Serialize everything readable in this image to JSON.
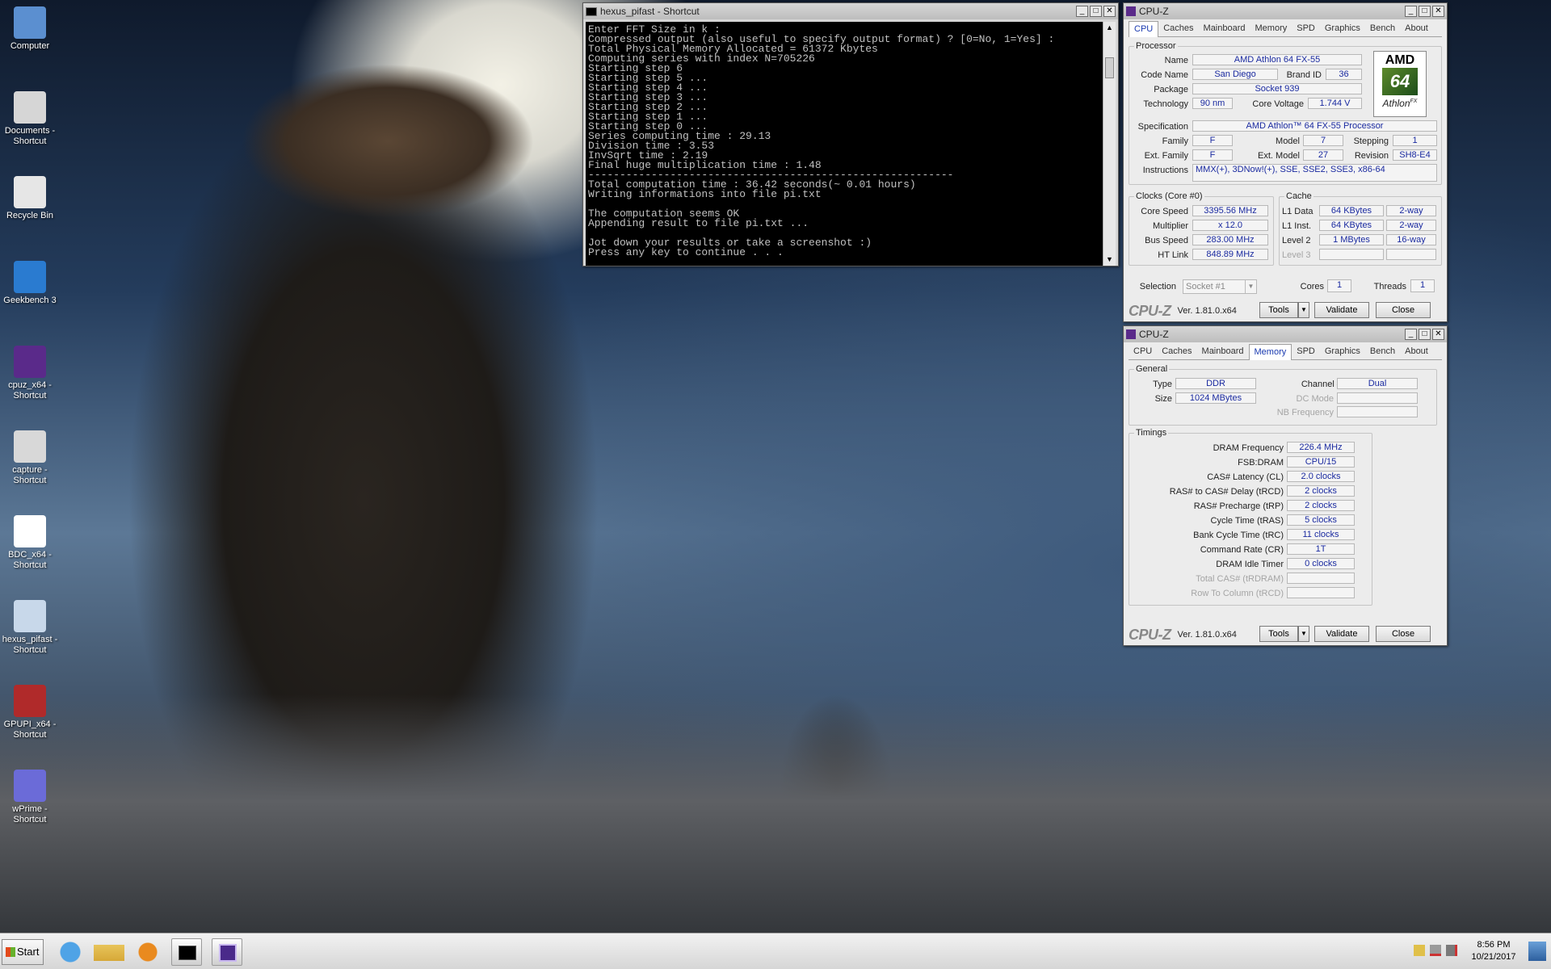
{
  "desktop": {
    "icons": [
      {
        "label": "Computer",
        "icon": "computer-icon"
      },
      {
        "label": "Documents - Shortcut",
        "icon": "documents-icon"
      },
      {
        "label": "Recycle Bin",
        "icon": "recycle-bin-icon"
      },
      {
        "label": "Geekbench 3",
        "icon": "geekbench-icon"
      },
      {
        "label": "cpuz_x64 - Shortcut",
        "icon": "cpuz-icon"
      },
      {
        "label": "capture - Shortcut",
        "icon": "capture-icon"
      },
      {
        "label": "BDC_x64 - Shortcut",
        "icon": "bdc-icon"
      },
      {
        "label": "hexus_pifast - Shortcut",
        "icon": "pifast-icon"
      },
      {
        "label": "GPUPI_x64 - Shortcut",
        "icon": "gpupi-icon"
      },
      {
        "label": "wPrime - Shortcut",
        "icon": "wprime-icon"
      }
    ]
  },
  "console": {
    "title": "hexus_pifast - Shortcut",
    "lines": [
      "Enter FFT Size in k :",
      "Compressed output (also useful to specify output format) ? [0=No, 1=Yes] :",
      "Total Physical Memory Allocated = 61372 Kbytes",
      "Computing series with index N=705226",
      "Starting step 6",
      "Starting step 5 ...",
      "Starting step 4 ...",
      "Starting step 3 ...",
      "Starting step 2 ...",
      "Starting step 1 ...",
      "Starting step 0 ...",
      "Series computing time : 29.13",
      "Division time : 3.53",
      "InvSqrt time : 2.19",
      "Final huge multiplication time : 1.48",
      "----------------------------------------------------------",
      "Total computation time : 36.42 seconds(~ 0.01 hours)",
      "Writing informations into file pi.txt",
      "",
      "The computation seems OK",
      "Appending result to file pi.txt ...",
      "",
      "Jot down your results or take a screenshot :)",
      "Press any key to continue . . ."
    ]
  },
  "cpuz_common": {
    "title": "CPU-Z",
    "tabs": [
      "CPU",
      "Caches",
      "Mainboard",
      "Memory",
      "SPD",
      "Graphics",
      "Bench",
      "About"
    ],
    "logo": "CPU-Z",
    "version": "Ver. 1.81.0.x64",
    "tools_label": "Tools",
    "validate_label": "Validate",
    "close_label": "Close"
  },
  "cpu_tab": {
    "processor_group": "Processor",
    "name_label": "Name",
    "name": "AMD Athlon 64 FX-55",
    "codename_label": "Code Name",
    "codename": "San Diego",
    "brandid_label": "Brand ID",
    "brandid": "36",
    "package_label": "Package",
    "package": "Socket 939",
    "technology_label": "Technology",
    "technology": "90 nm",
    "corevoltage_label": "Core Voltage",
    "corevoltage": "1.744 V",
    "specification_label": "Specification",
    "specification": "AMD Athlon™ 64 FX-55 Processor",
    "family_label": "Family",
    "family": "F",
    "model_label": "Model",
    "model": "7",
    "stepping_label": "Stepping",
    "stepping": "1",
    "extfamily_label": "Ext. Family",
    "extfamily": "F",
    "extmodel_label": "Ext. Model",
    "extmodel": "27",
    "revision_label": "Revision",
    "revision": "SH8-E4",
    "instructions_label": "Instructions",
    "instructions": "MMX(+), 3DNow!(+), SSE, SSE2, SSE3, x86-64",
    "clocks_group": "Clocks (Core #0)",
    "corespeed_label": "Core Speed",
    "corespeed": "3395.56 MHz",
    "multiplier_label": "Multiplier",
    "multiplier": "x 12.0",
    "busspeed_label": "Bus Speed",
    "busspeed": "283.00 MHz",
    "htlink_label": "HT Link",
    "htlink": "848.89 MHz",
    "cache_group": "Cache",
    "l1data_label": "L1 Data",
    "l1data": "64 KBytes",
    "l1data_way": "2-way",
    "l1inst_label": "L1 Inst.",
    "l1inst": "64 KBytes",
    "l1inst_way": "2-way",
    "level2_label": "Level 2",
    "level2": "1 MBytes",
    "level2_way": "16-way",
    "level3_label": "Level 3",
    "selection_label": "Selection",
    "selection": "Socket #1",
    "cores_label": "Cores",
    "cores": "1",
    "threads_label": "Threads",
    "threads": "1",
    "amd_logo": {
      "brand": "AMD",
      "number": "64",
      "line": "Athlon",
      "suffix": "FX"
    }
  },
  "memory_tab": {
    "general_group": "General",
    "type_label": "Type",
    "type": "DDR",
    "size_label": "Size",
    "size": "1024 MBytes",
    "channel_label": "Channel #",
    "channel": "Dual",
    "dcmode_label": "DC Mode",
    "nbfreq_label": "NB Frequency",
    "timings_group": "Timings",
    "timings": [
      {
        "label": "DRAM Frequency",
        "value": "226.4 MHz",
        "disabled": false
      },
      {
        "label": "FSB:DRAM",
        "value": "CPU/15",
        "disabled": false
      },
      {
        "label": "CAS# Latency (CL)",
        "value": "2.0 clocks",
        "disabled": false
      },
      {
        "label": "RAS# to CAS# Delay (tRCD)",
        "value": "2 clocks",
        "disabled": false
      },
      {
        "label": "RAS# Precharge (tRP)",
        "value": "2 clocks",
        "disabled": false
      },
      {
        "label": "Cycle Time (tRAS)",
        "value": "5 clocks",
        "disabled": false
      },
      {
        "label": "Bank Cycle Time (tRC)",
        "value": "11 clocks",
        "disabled": false
      },
      {
        "label": "Command Rate (CR)",
        "value": "1T",
        "disabled": false
      },
      {
        "label": "DRAM Idle Timer",
        "value": "0 clocks",
        "disabled": false
      },
      {
        "label": "Total CAS# (tRDRAM)",
        "value": "",
        "disabled": true
      },
      {
        "label": "Row To Column (tRCD)",
        "value": "",
        "disabled": true
      }
    ]
  },
  "taskbar": {
    "start_label": "Start",
    "clock_time": "8:56 PM",
    "clock_date": "10/21/2017",
    "pinned": [
      "internet-explorer-icon",
      "file-explorer-icon",
      "media-player-icon",
      "command-prompt-icon",
      "cpuz-taskbar-icon"
    ]
  }
}
